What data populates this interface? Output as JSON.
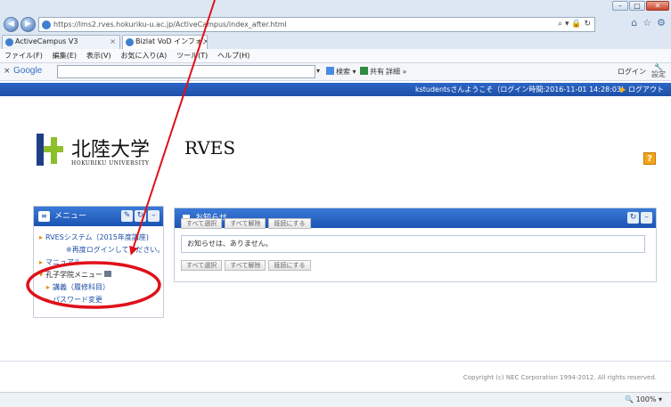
{
  "browser": {
    "url": "https://lms2.rves.hokuriku-u.ac.jp/ActiveCampus/index_after.html",
    "tabs": [
      {
        "label": "ActiveCampus V3"
      },
      {
        "label": "Bizlat VoD インフォメー..."
      }
    ],
    "menu": [
      "ファイル(F)",
      "編集(E)",
      "表示(V)",
      "お気に入り(A)",
      "ツール(T)",
      "ヘルプ(H)"
    ],
    "toolbar": {
      "google": "Google",
      "search_label": "検索",
      "share_label": "共有",
      "more_label": "詳細 »",
      "login": "ログイン",
      "settings": "設定"
    },
    "zoom": "100%"
  },
  "header": {
    "welcome": "kstudentsさんようこそ（ログイン時間:2016-11-01 14:28:03）",
    "logout": "ログアウト"
  },
  "logo": {
    "name": "北陸大学",
    "sub": "HOKURIKU UNIVERSITY",
    "system": "RVES"
  },
  "help": "?",
  "menu_portlet": {
    "title": "メニュー",
    "items": [
      {
        "label": "RVESシステム（2015年度講座)"
      },
      {
        "label": "※再度ログインしてください。"
      },
      {
        "label": "マニュアル"
      },
      {
        "label": "孔子学院メニュー"
      },
      {
        "label": "講義（履修科目）"
      },
      {
        "label": "パスワード変更"
      }
    ]
  },
  "notice_portlet": {
    "title": "お知らせ",
    "buttons": [
      "すべて選択",
      "すべて解除",
      "既読にする"
    ],
    "empty_message": "お知らせは、ありません。"
  },
  "footer": {
    "copyright": "Copyright (c) NEC Corporation 1994-2012. All rights reserved."
  },
  "colors": {
    "primary_blue": "#1b54b3",
    "annotation_red": "#e0101a",
    "accent_orange": "#f3a31a",
    "logo_green": "#8cbf2a"
  }
}
